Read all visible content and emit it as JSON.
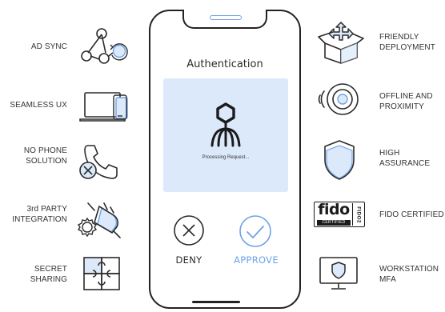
{
  "colors": {
    "stroke": "#2b2b2b",
    "accent": "#6ea2e6",
    "accent_fill": "#dce9fb",
    "approve_text": "#6ea2e6"
  },
  "phone": {
    "title": "Authentication",
    "processing": "Processing Request...",
    "deny_label": "DENY",
    "approve_label": "APPROVE",
    "logo_icon": "octopus-logo-icon"
  },
  "features_left": [
    {
      "id": "ad-sync",
      "label": "AD SYNC",
      "icon": "network-sync-icon"
    },
    {
      "id": "seamless-ux",
      "label": "SEAMLESS UX",
      "icon": "laptop-phone-icon"
    },
    {
      "id": "no-phone",
      "label": "NO PHONE\nSOLUTION",
      "icon": "no-phone-icon"
    },
    {
      "id": "integration",
      "label": "3rd PARTY\nINTEGRATION",
      "icon": "plug-gear-icon"
    },
    {
      "id": "secret-sharing",
      "label": "SECRET\nSHARING",
      "icon": "puzzle-icon"
    }
  ],
  "features_right": [
    {
      "id": "friendly-deployment",
      "label": "FRIENDLY\nDEPLOYMENT",
      "icon": "open-box-icon"
    },
    {
      "id": "offline",
      "label": "OFFLINE AND\nPROXIMITY",
      "icon": "proximity-icon"
    },
    {
      "id": "high-assurance",
      "label": "HIGH\nASSURANCE",
      "icon": "shield-icon"
    },
    {
      "id": "fido",
      "label": "FIDO CERTIFIED",
      "icon": "fido-badge-icon",
      "badge_main": "fido",
      "badge_sub": "CERTIFIED",
      "badge_side": "FIDO2"
    },
    {
      "id": "workstation",
      "label": "WORKSTATION\nMFA",
      "icon": "monitor-shield-icon"
    }
  ]
}
